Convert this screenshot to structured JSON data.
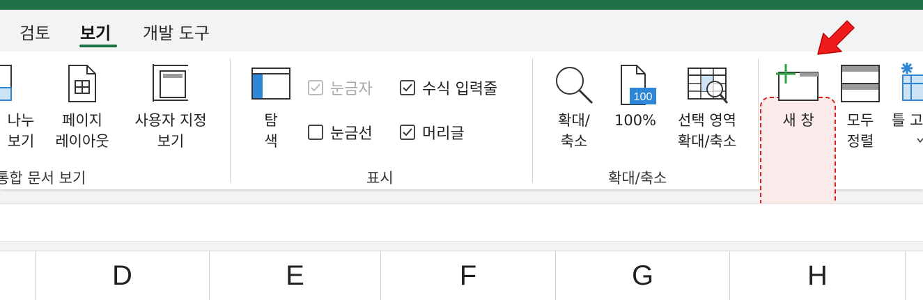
{
  "tabs": [
    {
      "label": "검토",
      "active": false
    },
    {
      "label": "보기",
      "active": true
    },
    {
      "label": "개발 도구",
      "active": false
    }
  ],
  "groups": {
    "workbook_views": {
      "label": "통합 문서 보기",
      "buttons": {
        "page_break": "나누\n보기",
        "page_layout": "페이지\n레이아웃",
        "custom_views": "사용자 지정\n보기"
      }
    },
    "show": {
      "label": "표시",
      "navigation": "탐\n색",
      "checks": [
        {
          "label": "눈금자",
          "checked": true,
          "disabled": true
        },
        {
          "label": "수식 입력줄",
          "checked": true,
          "disabled": false
        },
        {
          "label": "눈금선",
          "checked": false,
          "disabled": false
        },
        {
          "label": "머리글",
          "checked": true,
          "disabled": false
        }
      ]
    },
    "zoom": {
      "label": "확대/축소",
      "buttons": {
        "zoom": "확대/\n축소",
        "zoom_100": "100%",
        "zoom_to_selection": "선택 영역\n확대/축소",
        "badge_100": "100"
      }
    },
    "window": {
      "buttons": {
        "new_window": "새 창",
        "arrange_all": "모두\n정렬",
        "freeze_panes": "틀 고"
      }
    }
  },
  "columns": [
    "D",
    "E",
    "F",
    "G",
    "H"
  ],
  "colors": {
    "accent": "#1e7045",
    "highlight_border": "#e02020",
    "highlight_fill": "#fbeaea",
    "icon_blue": "#2e86d6",
    "new_window_plus": "#2ea043"
  }
}
